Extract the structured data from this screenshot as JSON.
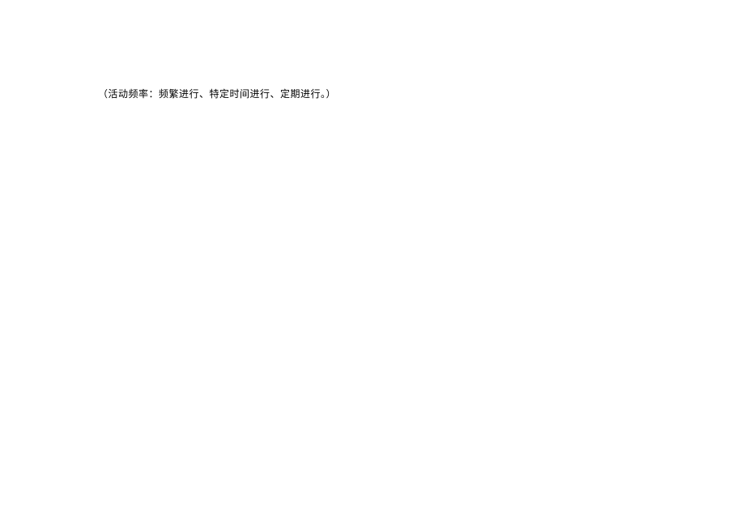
{
  "document": {
    "line1": "（活动频率：频繁进行、特定时间进行、定期进行。）"
  }
}
